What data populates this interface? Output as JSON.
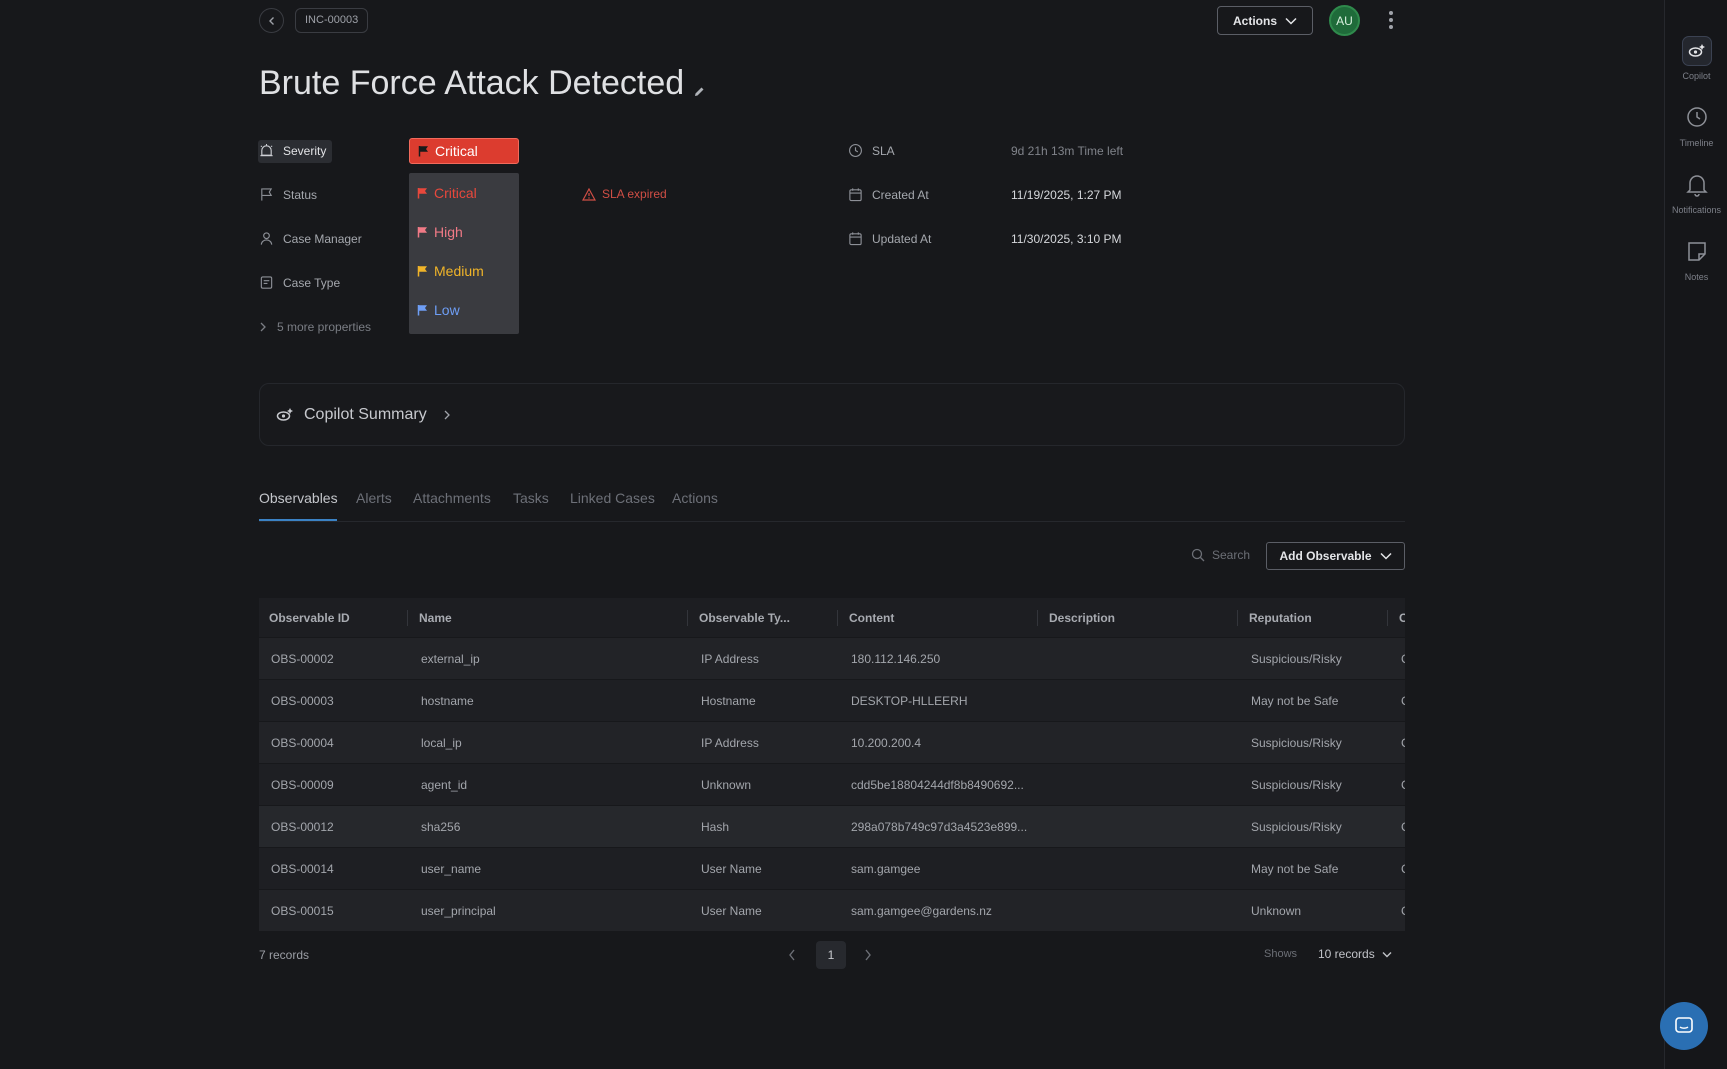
{
  "header": {
    "case_id": "INC-00003",
    "actions_label": "Actions",
    "avatar_initials": "AU",
    "title": "Brute Force Attack Detected"
  },
  "properties": {
    "severity_label": "Severity",
    "severity_value": "Critical",
    "status_label": "Status",
    "case_manager_label": "Case Manager",
    "case_type_label": "Case Type",
    "more_label": "5 more properties",
    "sla_expired": "SLA expired",
    "sla_label": "SLA",
    "sla_value": "9d 21h 13m  Time left",
    "created_label": "Created At",
    "created_value": "11/19/2025, 1:27 PM",
    "updated_label": "Updated At",
    "updated_value": "11/30/2025, 3:10 PM"
  },
  "severity_options": [
    {
      "label": "Critical",
      "color": "#e8483c"
    },
    {
      "label": "High",
      "color": "#f07a86"
    },
    {
      "label": "Medium",
      "color": "#f0b429"
    },
    {
      "label": "Low",
      "color": "#6e9ef5"
    }
  ],
  "copilot": {
    "summary_label": "Copilot Summary"
  },
  "tabs": [
    "Observables",
    "Alerts",
    "Attachments",
    "Tasks",
    "Linked Cases",
    "Actions"
  ],
  "toolbar": {
    "search_placeholder": "Search",
    "add_label": "Add Observable"
  },
  "table": {
    "columns": [
      "Observable ID",
      "Name",
      "Observable Ty...",
      "Content",
      "Description",
      "Reputation",
      "C"
    ],
    "rows": [
      [
        "OBS-00002",
        "external_ip",
        "IP Address",
        "180.112.146.250",
        "",
        "Suspicious/Risky",
        "C"
      ],
      [
        "OBS-00003",
        "hostname",
        "Hostname",
        "DESKTOP-HLLEERH",
        "",
        "May not be Safe",
        "C"
      ],
      [
        "OBS-00004",
        "local_ip",
        "IP Address",
        "10.200.200.4",
        "",
        "Suspicious/Risky",
        "C"
      ],
      [
        "OBS-00009",
        "agent_id",
        "Unknown",
        "cdd5be18804244df8b8490692...",
        "",
        "Suspicious/Risky",
        "C"
      ],
      [
        "OBS-00012",
        "sha256",
        "Hash",
        "298a078b749c97d3a4523e899...",
        "",
        "Suspicious/Risky",
        "C"
      ],
      [
        "OBS-00014",
        "user_name",
        "User Name",
        "sam.gamgee",
        "",
        "May not be Safe",
        "C"
      ],
      [
        "OBS-00015",
        "user_principal",
        "User Name",
        "sam.gamgee@gardens.nz",
        "",
        "Unknown",
        "C"
      ]
    ]
  },
  "footer": {
    "records": "7 records",
    "page": "1",
    "shows_label": "Shows",
    "per_page": "10 records"
  },
  "rail": {
    "copilot": "Copilot",
    "timeline": "Timeline",
    "notifications": "Notifications",
    "notes": "Notes"
  },
  "colors": {
    "accent": "#3b82c4",
    "critical": "#dc3c2f",
    "sla_expired": "#d04e45"
  }
}
